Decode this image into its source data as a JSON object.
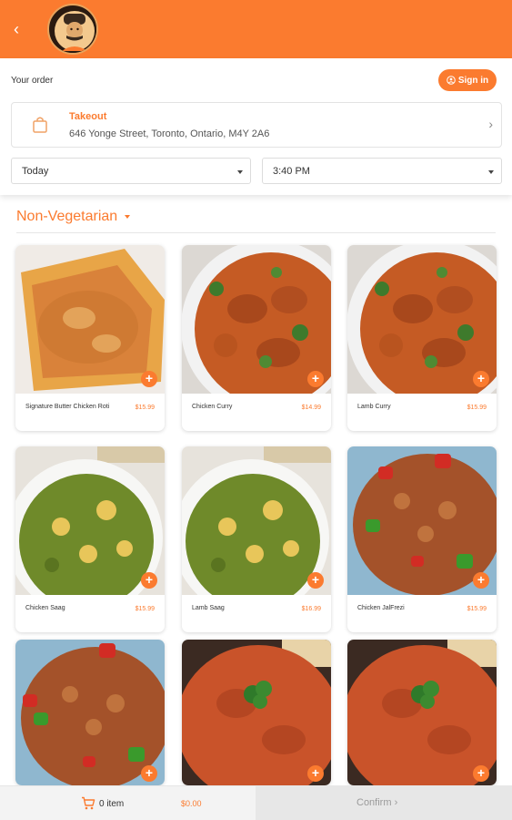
{
  "header": {
    "back_icon": "chevron-left-icon",
    "logo_icon": "chef-logo-icon",
    "brand_color": "#fb7b2f"
  },
  "order": {
    "title": "Your order",
    "signin_label": "Sign in",
    "signin_icon": "user-circle-icon",
    "method": "Takeout",
    "address": "646 Yonge Street, Toronto, Ontario, M4Y 2A6",
    "day": "Today",
    "time": "3:40 PM"
  },
  "menu": {
    "category": "Non-Vegetarian",
    "items": [
      {
        "name": "Signature Butter Chicken Roti",
        "price": "$15.99"
      },
      {
        "name": "Chicken Curry",
        "price": "$14.99"
      },
      {
        "name": "Lamb Curry",
        "price": "$15.99"
      },
      {
        "name": "Chicken Saag",
        "price": "$15.99"
      },
      {
        "name": "Lamb Saag",
        "price": "$16.99"
      },
      {
        "name": "Chicken JalFrezi",
        "price": "$15.99"
      },
      {
        "name": "",
        "price": ""
      },
      {
        "name": "",
        "price": ""
      },
      {
        "name": "",
        "price": ""
      }
    ]
  },
  "cart": {
    "count_label": "0 item",
    "total": "$0.00",
    "confirm_label": "Confirm"
  }
}
